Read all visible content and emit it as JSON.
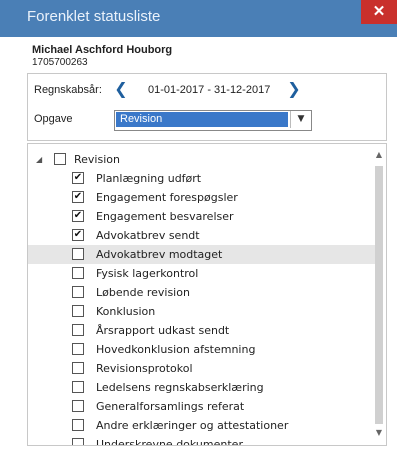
{
  "window": {
    "title": "Forenklet statusliste",
    "close_label": "✕"
  },
  "client": {
    "name": "Michael Aschford Houborg",
    "id": "1705700263"
  },
  "filters": {
    "regnskabsaar_label": "Regnskabsår:",
    "period": "01-01-2017 - 31-12-2017",
    "opgave_label": "Opgave",
    "opgave_value": "Revision"
  },
  "tree": {
    "root": {
      "label": "Revision",
      "checked": false
    },
    "items": [
      {
        "label": "Planlægning udført",
        "checked": true
      },
      {
        "label": "Engagement forespøgsler",
        "checked": true
      },
      {
        "label": "Engagement besvarelser",
        "checked": true
      },
      {
        "label": "Advokatbrev sendt",
        "checked": true
      },
      {
        "label": "Advokatbrev modtaget",
        "checked": false,
        "highlight": true
      },
      {
        "label": "Fysisk lagerkontrol",
        "checked": false
      },
      {
        "label": "Løbende revision",
        "checked": false
      },
      {
        "label": "Konklusion",
        "checked": false
      },
      {
        "label": "Årsrapport udkast sendt",
        "checked": false
      },
      {
        "label": "Hovedkonklusion afstemning",
        "checked": false
      },
      {
        "label": "Revisionsprotokol",
        "checked": false
      },
      {
        "label": "Ledelsens regnskabserklæring",
        "checked": false
      },
      {
        "label": "Generalforsamlings referat",
        "checked": false
      },
      {
        "label": "Andre erklæringer og attestationer",
        "checked": false
      },
      {
        "label": "Underskrevne dokumenter",
        "checked": false
      }
    ]
  },
  "colors": {
    "titlebar": "#4a7fb6",
    "close": "#c9302c",
    "accent": "#3a78c9"
  }
}
